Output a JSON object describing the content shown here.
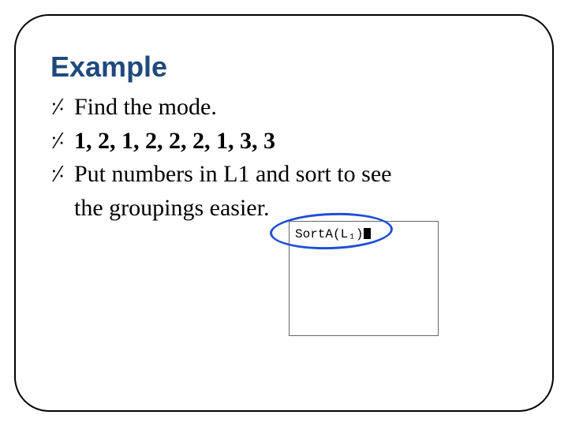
{
  "title": "Example",
  "bullets": [
    {
      "mark": "⸓",
      "text": "Find the mode.",
      "bold": false
    },
    {
      "mark": "⸓",
      "text": "1, 2, 1, 2, 2, 2, 1, 3, 3",
      "bold": true
    },
    {
      "mark": "⸓",
      "text": "Put numbers in L1 and sort to see",
      "bold": false
    },
    {
      "mark": "",
      "text": "the groupings easier.",
      "bold": false
    }
  ],
  "calc": {
    "line": "SortA(L₁)"
  },
  "colors": {
    "title": "#1f497d",
    "annotation": "#1f4fd6"
  }
}
